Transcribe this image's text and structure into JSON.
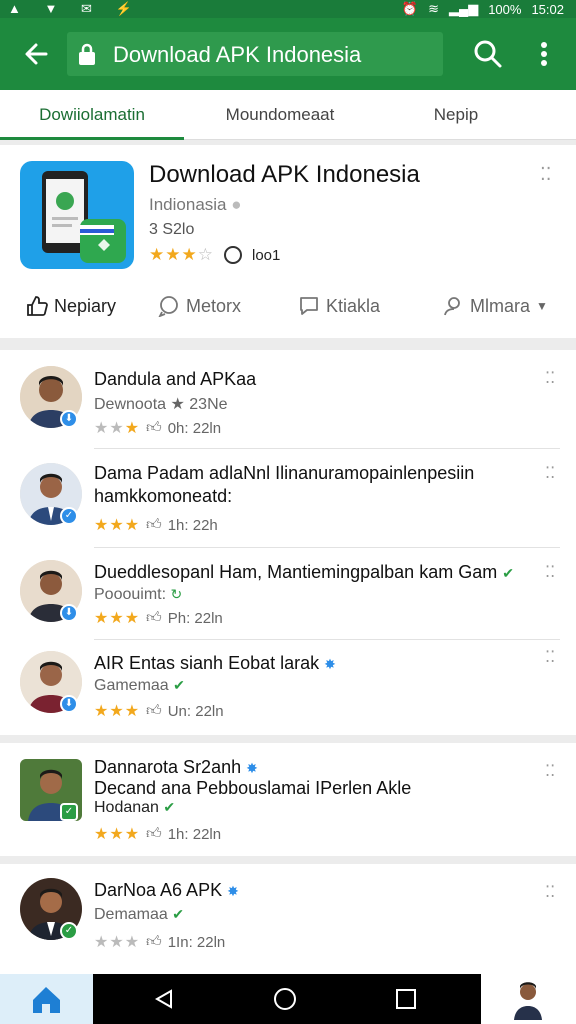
{
  "status_bar": {
    "battery": "100%",
    "time": "15:02"
  },
  "app_bar": {
    "title": "Download APK Indonesia"
  },
  "tabs": [
    {
      "label": "Dowiiolamatin",
      "active": true
    },
    {
      "label": "Moundomeaat",
      "active": false
    },
    {
      "label": "Nepip",
      "active": false
    }
  ],
  "app": {
    "name": "Download APK Indonesia",
    "developer": "Indionasia",
    "size": "3 S2lo",
    "rating": 3.5,
    "stars": "★★★",
    "star_off": "☆",
    "count": "loo1"
  },
  "actions": [
    {
      "label": "Nepiary",
      "icon": "thumb-up-icon"
    },
    {
      "label": "Metorx",
      "icon": "comment-icon"
    },
    {
      "label": "Ktiakla",
      "icon": "chat-icon"
    },
    {
      "label": "Mlmara",
      "icon": "people-icon"
    }
  ],
  "items": [
    {
      "title": "Dandula and APKaa",
      "sub": "Dewnoota ★ 23Ne",
      "meta": "0h: 22ln",
      "verify": "none"
    },
    {
      "title": "Dama Padam adlaNnl Ilinanuramopainlenpesiin",
      "title2": "hamkkomoneatd:",
      "meta": "1h: 22h",
      "verify": "none"
    },
    {
      "title": "Dueddlesopanl Ham, Mantiemingpalban kam Gam",
      "sub": "Pooouimt:",
      "meta": "Ph: 22ln",
      "verify": "green"
    },
    {
      "title": "AIR Entas sianh Eobat larak",
      "sub": "Gamemaa",
      "meta": "Un: 22ln",
      "verify": "blue"
    },
    {
      "title": "Dannarota Sr2anh",
      "title2": "Decand ana Pebbouslamai IPerlen Akle",
      "sub": "Hodanan",
      "meta": "1h: 22ln",
      "verify": "blue"
    },
    {
      "title": "DarNoa A6 APK",
      "sub": "Demamaa",
      "meta": "1In: 22ln",
      "verify": "blue"
    }
  ],
  "colors": {
    "primary": "#1e8a3e",
    "star": "#f2a81d",
    "verified_green": "#2a9d44",
    "verified_blue": "#2e8ee8"
  }
}
